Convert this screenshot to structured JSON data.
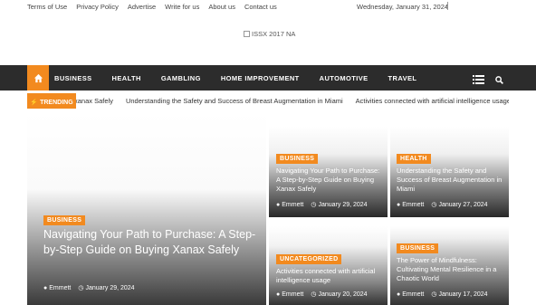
{
  "top": {
    "links": [
      "Terms of Use",
      "Privacy Policy",
      "Advertise",
      "Write for us",
      "About us",
      "Contact us"
    ],
    "date": "Wednesday, January 31, 2024"
  },
  "logo": {
    "alt": "ISSX 2017 NA"
  },
  "nav": {
    "items": [
      "BUSINESS",
      "HEALTH",
      "GAMBLING",
      "HOME IMPROVEMENT",
      "AUTOMOTIVE",
      "TRAVEL"
    ],
    "icons": [
      "home-icon",
      "menu-icon",
      "search-icon"
    ]
  },
  "trending": {
    "label": "TRENDING",
    "items": [
      "xanax Safely",
      "Understanding the Safety and Success of Breast Augmentation in Miami",
      "Activities connected with artificial intelligence usage"
    ]
  },
  "posts": {
    "featured": {
      "category": "BUSINESS",
      "title": "Navigating Your Path to Purchase: A Step-by-Step Guide on Buying Xanax Safely",
      "author": "Emmett",
      "date": "January 29, 2024"
    },
    "p1": {
      "category": "BUSINESS",
      "title": "Navigating Your Path to Purchase: A Step-by-Step Guide on Buying Xanax Safely",
      "author": "Emmett",
      "date": "January 29, 2024"
    },
    "p2": {
      "category": "HEALTH",
      "title": "Understanding the Safety and Success of Breast Augmentation in Miami",
      "author": "Emmett",
      "date": "January 27, 2024"
    },
    "p3": {
      "category": "UNCATEGORIZED",
      "title": "Activities connected with artificial intelligence usage",
      "author": "Emmett",
      "date": "January 20, 2024"
    },
    "p4": {
      "category": "BUSINESS",
      "title": "The Power of Mindfulness: Cultivating Mental Resilience in a Chaotic World",
      "author": "Emmett",
      "date": "January 17, 2024"
    }
  },
  "colors": {
    "accent": "#f28a1f",
    "nav": "#2c2c2c"
  }
}
